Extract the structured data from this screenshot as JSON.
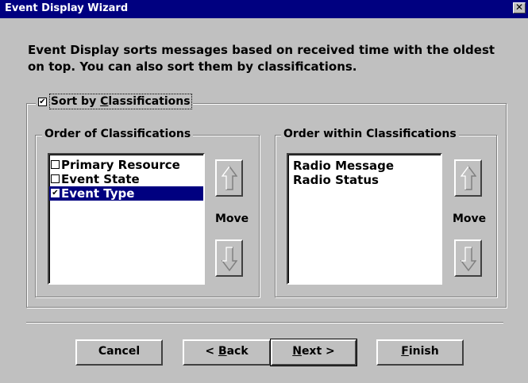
{
  "window": {
    "title": "Event Display Wizard",
    "close_glyph": "✕"
  },
  "intro_text": "Event Display sorts messages based on received time with the oldest on top. You can also sort them by classifications.",
  "sort_group": {
    "checkbox_checked": true,
    "label_pre": "Sort by ",
    "label_accel": "C",
    "label_post": "lassifications"
  },
  "order_group": {
    "title": "Order of Classifications",
    "items": [
      {
        "label": "Primary Resource",
        "checked": false,
        "selected": false
      },
      {
        "label": "Event State",
        "checked": false,
        "selected": false
      },
      {
        "label": "Event Type",
        "checked": true,
        "selected": true
      }
    ],
    "move_label": "Move"
  },
  "within_group": {
    "title": "Order within Classifications",
    "items": [
      "Radio Message",
      "Radio Status"
    ],
    "move_label": "Move"
  },
  "buttons": {
    "cancel": "Cancel",
    "back_pre": "< ",
    "back_accel": "B",
    "back_post": "ack",
    "next_accel": "N",
    "next_post": "ext >",
    "finish_accel": "F",
    "finish_post": "inish"
  },
  "icons": {
    "up_arrow": "up-arrow-icon",
    "down_arrow": "down-arrow-icon",
    "check": "✔"
  }
}
